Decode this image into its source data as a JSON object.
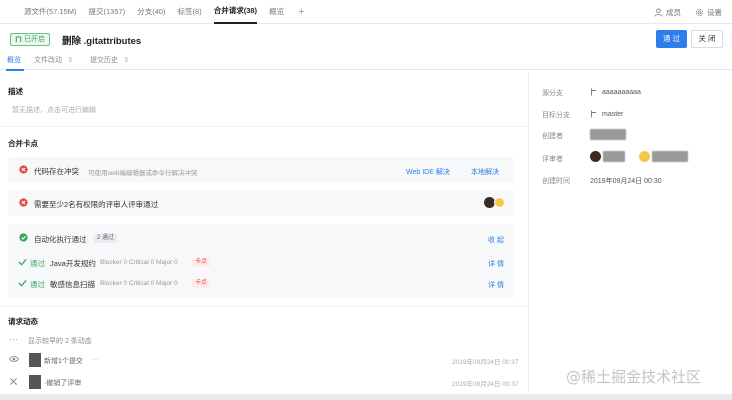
{
  "top_tabs": [
    {
      "label": "源文件(57.15M)"
    },
    {
      "label": "提交(1357)"
    },
    {
      "label": "分支(40)"
    },
    {
      "label": "标签(8)"
    },
    {
      "label": "合并请求(38)",
      "active": true
    },
    {
      "label": "概览"
    }
  ],
  "top_actions": {
    "members": "成员",
    "settings": "设置"
  },
  "header": {
    "status_badge": "已开启",
    "title": "删除 .gitattributes",
    "approve_button": "通 过",
    "close_button": "关 闭"
  },
  "sub_tabs": [
    {
      "label": "概览",
      "active": true
    },
    {
      "label": "文件改动",
      "count": "3"
    },
    {
      "label": "提交历史",
      "count": "3"
    }
  ],
  "description": {
    "title": "描述",
    "placeholder": "暂无描述，点击可进行编辑"
  },
  "merge_checks": {
    "title": "合并卡点",
    "conflict": {
      "label": "代码存在冲突",
      "hint": "可使用web端编辑器或命令行解决冲突",
      "web_ide_link": "Web IDE 解决",
      "local_link": "本地解决"
    },
    "review": {
      "label": "需要至少2名有权限的评审人评审通过"
    },
    "ci": {
      "label": "自动化执行通过",
      "pill": "2 通过",
      "collapse_link": "收 起",
      "items": [
        {
          "status": "通过",
          "name": "Java开发规约",
          "stats": "Blocker 0  Critical 0  Major 0",
          "tag": "卡点",
          "link": "详 情"
        },
        {
          "status": "通过",
          "name": "敏感信息扫描",
          "stats": "Blocker 0  Critical 0  Major 0",
          "tag": "卡点",
          "link": "详 情"
        }
      ]
    }
  },
  "activity": {
    "title": "请求动态",
    "show_earlier": "显示较早的 2 条动态",
    "items": [
      {
        "text": "新增1个提交",
        "more": "···",
        "time": "2019年09月24日 00:37"
      },
      {
        "text": "·撤销了评审",
        "time": "2019年09月24日 00:37"
      }
    ]
  },
  "meta": {
    "source_branch_label": "源分支",
    "source_branch_value": "aaaaaaaaaa",
    "target_branch_label": "目标分支",
    "target_branch_value": "master",
    "creator_label": "创建者",
    "reviewers_label": "评审者",
    "created_at_label": "创建时间",
    "created_at_value": "2019年09月24日 00:30"
  },
  "watermark": "@稀土掘金技术社区",
  "colors": {
    "accent": "#2d7ee8",
    "success": "#3aa55d",
    "error": "#e24a3b"
  }
}
